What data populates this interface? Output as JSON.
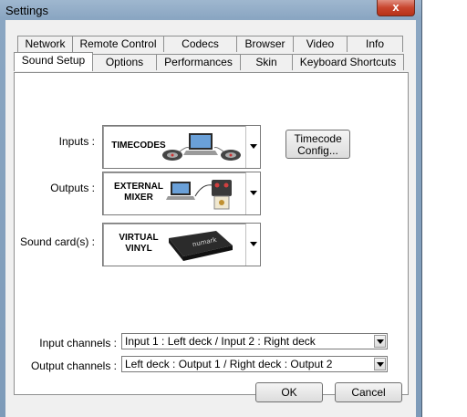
{
  "window": {
    "title": "Settings",
    "close_glyph": "x"
  },
  "tabs_back": [
    {
      "label": "Network"
    },
    {
      "label": "Remote Control"
    },
    {
      "label": "Codecs"
    },
    {
      "label": "Browser"
    },
    {
      "label": "Video"
    },
    {
      "label": "Info"
    }
  ],
  "tabs_front": [
    {
      "label": "Sound Setup",
      "active": true
    },
    {
      "label": "Options"
    },
    {
      "label": "Performances"
    },
    {
      "label": "Skin"
    },
    {
      "label": "Keyboard Shortcuts"
    }
  ],
  "sound_setup": {
    "inputs": {
      "label": "Inputs :",
      "value": "TIMECODES",
      "icon": "turntables-laptop-icon"
    },
    "outputs": {
      "label": "Outputs :",
      "value": "EXTERNAL MIXER",
      "icon": "external-mixer-icon"
    },
    "soundcard": {
      "label": "Sound card(s) :",
      "value": "VIRTUAL VINYL",
      "icon": "numark-soundcard-icon"
    },
    "timecode_button": "Timecode Config...",
    "input_channels": {
      "label": "Input channels :",
      "value": "Input 1 : Left deck / Input 2 : Right deck"
    },
    "output_channels": {
      "label": "Output channels :",
      "value": "Left deck : Output 1 / Right deck : Output 2"
    }
  },
  "footer": {
    "ok": "OK",
    "cancel": "Cancel"
  },
  "colors": {
    "close_button": "#c8452d",
    "titlebar": "#9fb7cf",
    "dialog_bg": "#f0f0f0"
  }
}
